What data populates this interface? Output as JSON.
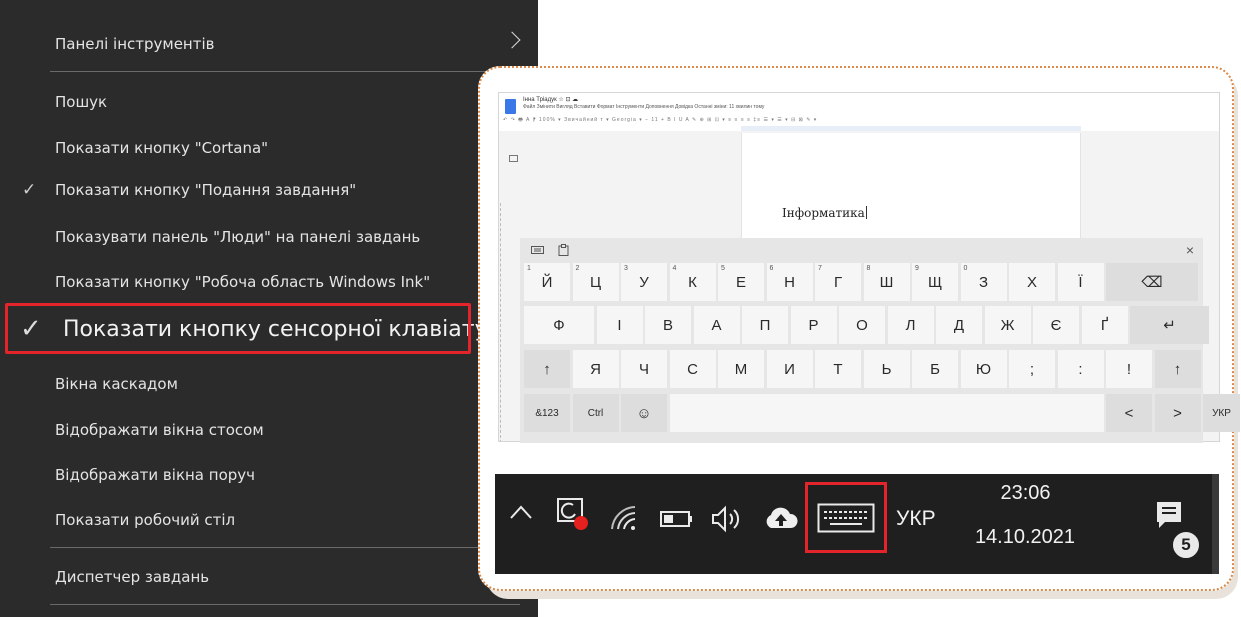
{
  "context_menu": {
    "items": [
      {
        "label": "Панелі інструментів",
        "submenu": true
      },
      {
        "label": "Пошук"
      },
      {
        "label": "Показати кнопку \"Cortana\""
      },
      {
        "label": "Показати кнопку \"Подання завдання\"",
        "checked": true
      },
      {
        "label": "Показувати панель \"Люди\" на панелі завдань"
      },
      {
        "label": "Показати кнопку \"Робоча область Windows Ink\""
      },
      {
        "label": "Показати кнопку сенсорної клавіатури",
        "checked": true,
        "highlighted": true
      },
      {
        "label": "Вікна каскадом"
      },
      {
        "label": "Відображати вікна стосом"
      },
      {
        "label": "Відображати вікна поруч"
      },
      {
        "label": "Показати робочий стіл"
      },
      {
        "label": "Диспетчер завдань"
      }
    ],
    "check_glyph": "✓",
    "highlight_color": "#e3242b"
  },
  "docs": {
    "title": "Інна Тріадук ☆ ⊡ ☁",
    "menus": "Файл  Змінити  Вигляд  Вставити  Формат  Інструменти  Доповнення  Довідка  Останні зміни: 11 хвилин тому",
    "toolbar": "↶ ↷ 🖶 A ⁋  100% ▾  Звичайний т ▾  Georgia ▾  − 11 +  B I U A ✎  ⊕ ⊞ ⊡ ▾  ≡ ≡ ≡ ≡  ‡≡  ☰ ▾ ☰ ▾  ⊟ ⊠  ✎ ▾",
    "body_text": "Інформатика"
  },
  "keyboard": {
    "row1": [
      {
        "label": "й",
        "num": "1"
      },
      {
        "label": "ц",
        "num": "2"
      },
      {
        "label": "у",
        "num": "3"
      },
      {
        "label": "к",
        "num": "4"
      },
      {
        "label": "е",
        "num": "5"
      },
      {
        "label": "н",
        "num": "6"
      },
      {
        "label": "г",
        "num": "7"
      },
      {
        "label": "ш",
        "num": "8"
      },
      {
        "label": "щ",
        "num": "9"
      },
      {
        "label": "з",
        "num": "0"
      },
      {
        "label": "х",
        "num": ""
      },
      {
        "label": "ї",
        "num": ""
      }
    ],
    "backspace": "⌫",
    "row2": [
      "ф",
      "і",
      "в",
      "а",
      "п",
      "р",
      "о",
      "л",
      "д",
      "ж",
      "є",
      "ґ"
    ],
    "enter": "↵",
    "row3": [
      "↑",
      "я",
      "ч",
      "с",
      "м",
      "и",
      "т",
      "ь",
      "б",
      "ю",
      ";",
      ":",
      "!",
      "↑"
    ],
    "row4": {
      "symbols": "&123",
      "ctrl": "Ctrl",
      "emoji": "☺",
      "left": "<",
      "right": ">",
      "lang": "УКР"
    },
    "close": "×"
  },
  "taskbar": {
    "language": "УКР",
    "time": "23:06",
    "date": "14.10.2021",
    "notification_count": "5"
  }
}
